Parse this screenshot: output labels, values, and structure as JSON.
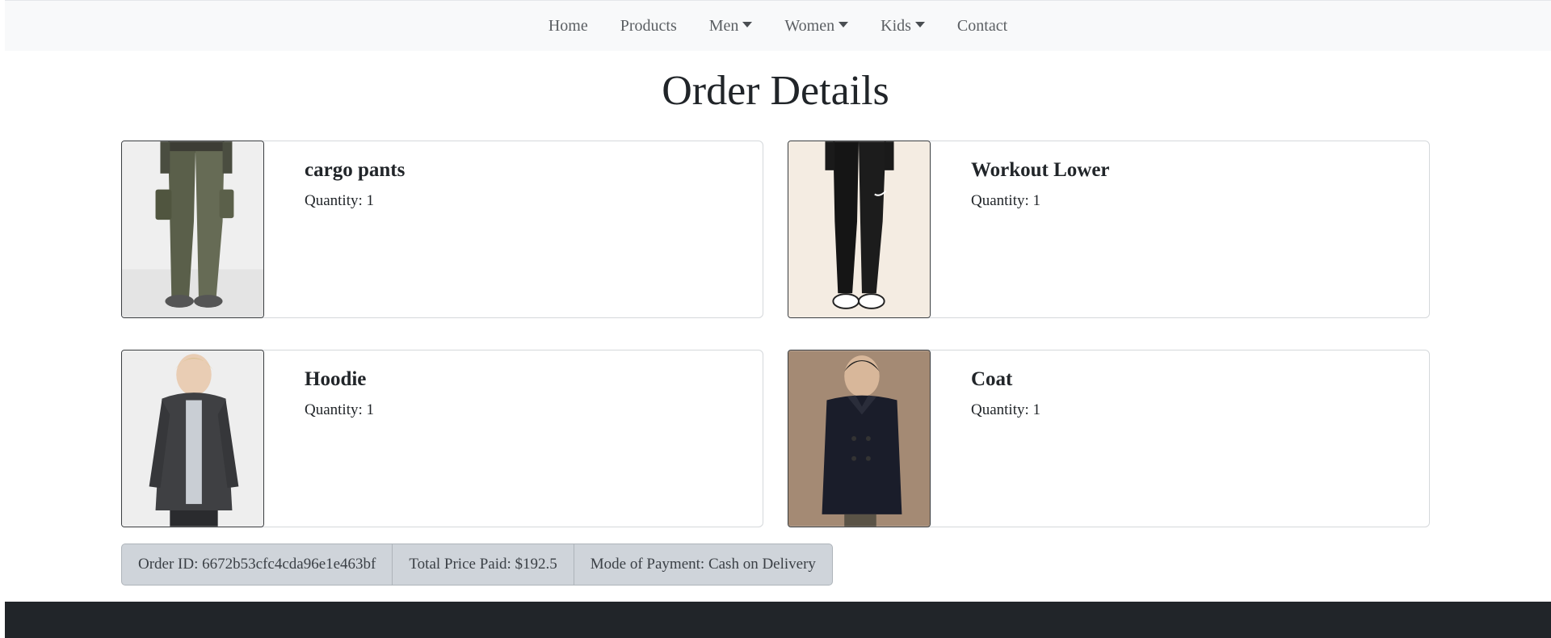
{
  "nav": {
    "items": [
      {
        "label": "Home",
        "dropdown": false
      },
      {
        "label": "Products",
        "dropdown": false
      },
      {
        "label": "Men",
        "dropdown": true
      },
      {
        "label": "Women",
        "dropdown": true
      },
      {
        "label": "Kids",
        "dropdown": true
      },
      {
        "label": "Contact",
        "dropdown": false
      }
    ]
  },
  "page": {
    "title": "Order Details"
  },
  "order": {
    "items": [
      {
        "name": "cargo pants",
        "quantity": "Quantity: 1",
        "image": "cargo-pants-photo"
      },
      {
        "name": "Workout Lower",
        "quantity": "Quantity: 1",
        "image": "workout-lower-photo"
      },
      {
        "name": "Hoodie",
        "quantity": "Quantity: 1",
        "image": "hoodie-photo"
      },
      {
        "name": "Coat",
        "quantity": "Quantity: 1",
        "image": "coat-photo"
      }
    ],
    "summary": {
      "order_id": "Order ID: 6672b53cfc4cda96e1e463bf",
      "total_price": "Total Price Paid: $192.5",
      "payment_mode": "Mode of Payment: Cash on Delivery"
    }
  },
  "colors": {
    "navbar_bg": "#f8f9fa",
    "footer_bg": "#212529",
    "info_bar_bg": "#cfd4da"
  }
}
